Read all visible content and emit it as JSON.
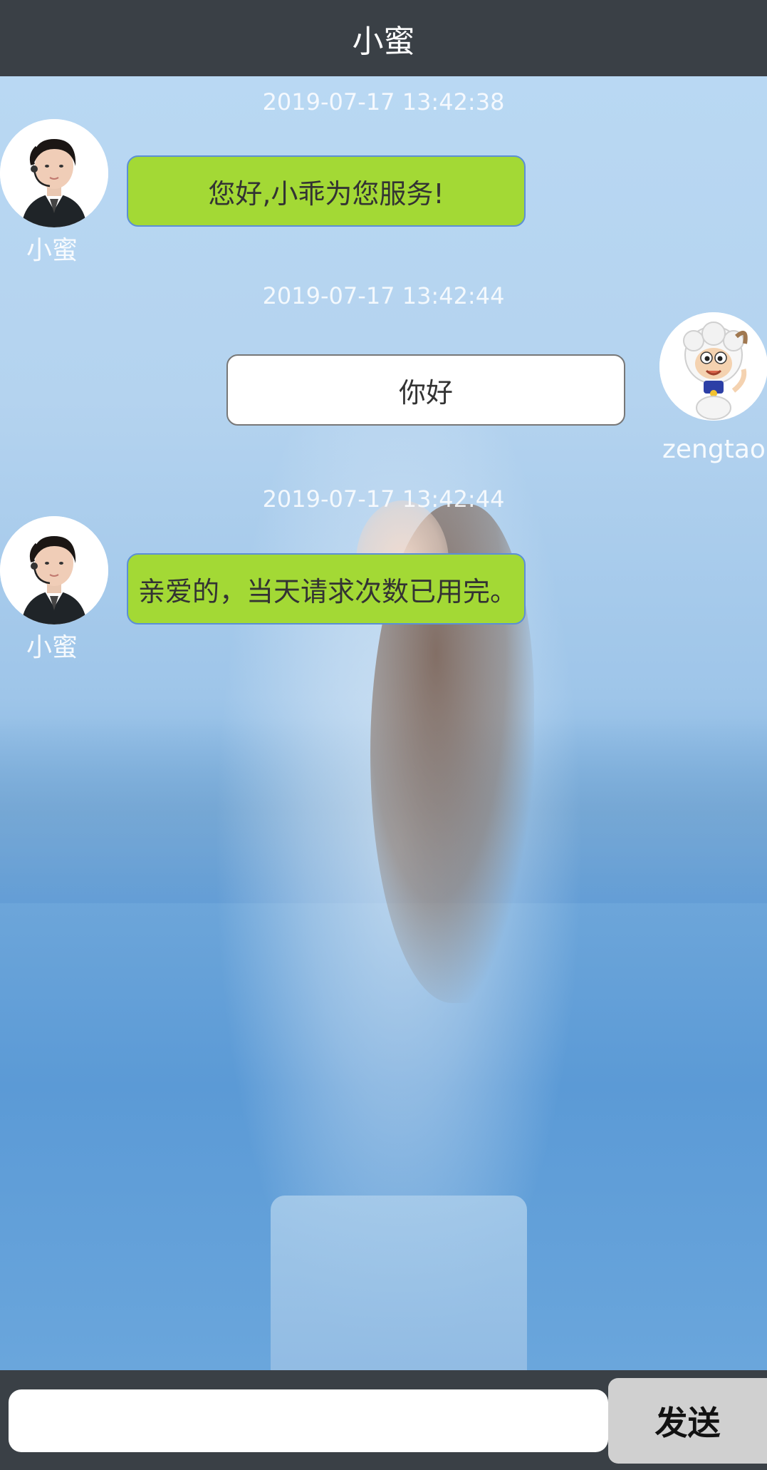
{
  "header": {
    "title": "小蜜"
  },
  "messages": [
    {
      "timestamp": "2019-07-17  13:42:38",
      "sender": "小蜜",
      "role": "bot",
      "text": "您好,小乖为您服务!",
      "avatar_icon": "customer-service-agent-avatar"
    },
    {
      "timestamp": "2019-07-17  13:42:44",
      "sender": "zengtao",
      "role": "user",
      "text": "你好",
      "avatar_icon": "cartoon-sheep-avatar"
    },
    {
      "timestamp": "2019-07-17  13:42:44",
      "sender": "小蜜",
      "role": "bot",
      "text": "亲爱的，当天请求次数已用完。",
      "avatar_icon": "customer-service-agent-avatar"
    }
  ],
  "composer": {
    "input_value": "",
    "send_label": "发送"
  },
  "colors": {
    "header_bg": "#3a4046",
    "bot_bubble": "#a3d935",
    "user_bubble": "#ffffff",
    "send_button": "#d0d0d0"
  }
}
